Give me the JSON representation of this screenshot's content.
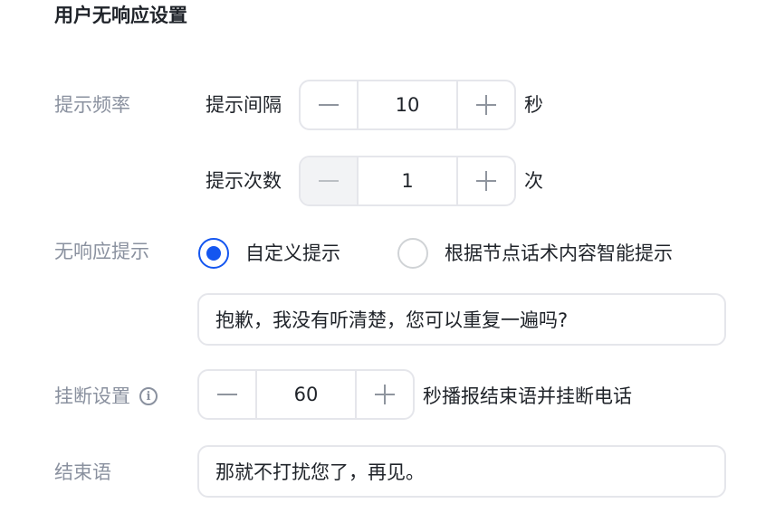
{
  "section_title": "用户无响应设置",
  "prompt_frequency": {
    "label": "提示频率",
    "interval": {
      "label": "提示间隔",
      "value": "10",
      "unit": "秒",
      "minus_icon": "minus-icon",
      "plus_icon": "plus-icon"
    },
    "count": {
      "label": "提示次数",
      "value": "1",
      "unit": "次",
      "minus_disabled": true
    }
  },
  "no_response_prompt": {
    "label": "无响应提示",
    "options": [
      {
        "label": "自定义提示",
        "checked": true
      },
      {
        "label": "根据节点话术内容智能提示",
        "checked": false
      }
    ],
    "custom_text": "抱歉，我没有听清楚，您可以重复一遍吗?"
  },
  "hangup": {
    "label": "挂断设置",
    "icon": "info-icon",
    "value": "60",
    "suffix": "秒播报结束语并挂断电话"
  },
  "ending": {
    "label": "结束语",
    "text": "那就不打扰您了，再见。"
  },
  "colors": {
    "accent": "#1456f0",
    "label_gray": "#8a919f",
    "border": "#e5e6eb",
    "disabled_bg": "#f2f3f5"
  }
}
